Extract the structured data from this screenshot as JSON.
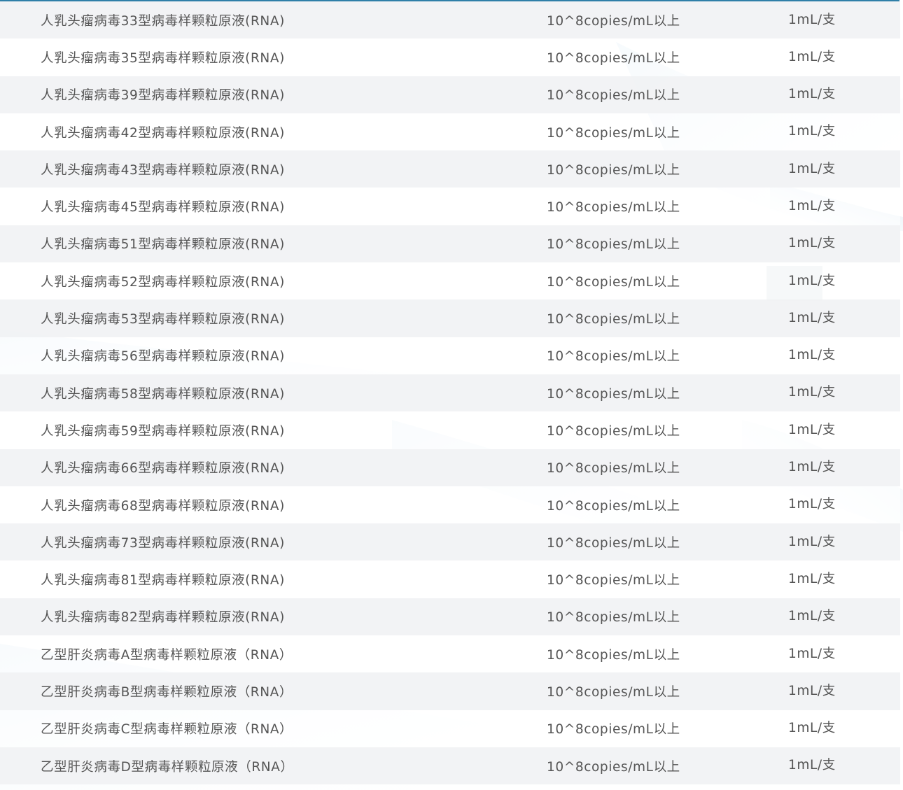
{
  "product_table": {
    "rows": [
      {
        "name": "人乳头瘤病毒33型病毒样颗粒原液(RNA)",
        "concentration": "10^8copies/mL以上",
        "spec": "1mL/支"
      },
      {
        "name": "人乳头瘤病毒35型病毒样颗粒原液(RNA)",
        "concentration": "10^8copies/mL以上",
        "spec": "1mL/支"
      },
      {
        "name": "人乳头瘤病毒39型病毒样颗粒原液(RNA)",
        "concentration": "10^8copies/mL以上",
        "spec": "1mL/支"
      },
      {
        "name": "人乳头瘤病毒42型病毒样颗粒原液(RNA)",
        "concentration": "10^8copies/mL以上",
        "spec": "1mL/支"
      },
      {
        "name": "人乳头瘤病毒43型病毒样颗粒原液(RNA)",
        "concentration": "10^8copies/mL以上",
        "spec": "1mL/支"
      },
      {
        "name": "人乳头瘤病毒45型病毒样颗粒原液(RNA)",
        "concentration": "10^8copies/mL以上",
        "spec": "1mL/支"
      },
      {
        "name": "人乳头瘤病毒51型病毒样颗粒原液(RNA)",
        "concentration": "10^8copies/mL以上",
        "spec": "1mL/支"
      },
      {
        "name": "人乳头瘤病毒52型病毒样颗粒原液(RNA)",
        "concentration": "10^8copies/mL以上",
        "spec": "1mL/支"
      },
      {
        "name": "人乳头瘤病毒53型病毒样颗粒原液(RNA)",
        "concentration": "10^8copies/mL以上",
        "spec": "1mL/支"
      },
      {
        "name": "人乳头瘤病毒56型病毒样颗粒原液(RNA)",
        "concentration": "10^8copies/mL以上",
        "spec": "1mL/支"
      },
      {
        "name": "人乳头瘤病毒58型病毒样颗粒原液(RNA)",
        "concentration": "10^8copies/mL以上",
        "spec": "1mL/支"
      },
      {
        "name": "人乳头瘤病毒59型病毒样颗粒原液(RNA)",
        "concentration": "10^8copies/mL以上",
        "spec": "1mL/支"
      },
      {
        "name": "人乳头瘤病毒66型病毒样颗粒原液(RNA)",
        "concentration": "10^8copies/mL以上",
        "spec": "1mL/支"
      },
      {
        "name": "人乳头瘤病毒68型病毒样颗粒原液(RNA)",
        "concentration": "10^8copies/mL以上",
        "spec": "1mL/支"
      },
      {
        "name": "人乳头瘤病毒73型病毒样颗粒原液(RNA)",
        "concentration": "10^8copies/mL以上",
        "spec": "1mL/支"
      },
      {
        "name": "人乳头瘤病毒81型病毒样颗粒原液(RNA)",
        "concentration": "10^8copies/mL以上",
        "spec": "1mL/支"
      },
      {
        "name": "人乳头瘤病毒82型病毒样颗粒原液(RNA)",
        "concentration": "10^8copies/mL以上",
        "spec": "1mL/支"
      },
      {
        "name": "乙型肝炎病毒A型病毒样颗粒原液（RNA）",
        "concentration": "10^8copies/mL以上",
        "spec": "1mL/支"
      },
      {
        "name": "乙型肝炎病毒B型病毒样颗粒原液（RNA）",
        "concentration": "10^8copies/mL以上",
        "spec": "1mL/支"
      },
      {
        "name": "乙型肝炎病毒C型病毒样颗粒原液（RNA）",
        "concentration": "10^8copies/mL以上",
        "spec": "1mL/支"
      },
      {
        "name": "乙型肝炎病毒D型病毒样颗粒原液（RNA）",
        "concentration": "10^8copies/mL以上",
        "spec": "1mL/支"
      }
    ]
  },
  "colors": {
    "top_rule": "#2f7fa8",
    "row_stripe": "#f1f2f4",
    "text": "#555555"
  }
}
